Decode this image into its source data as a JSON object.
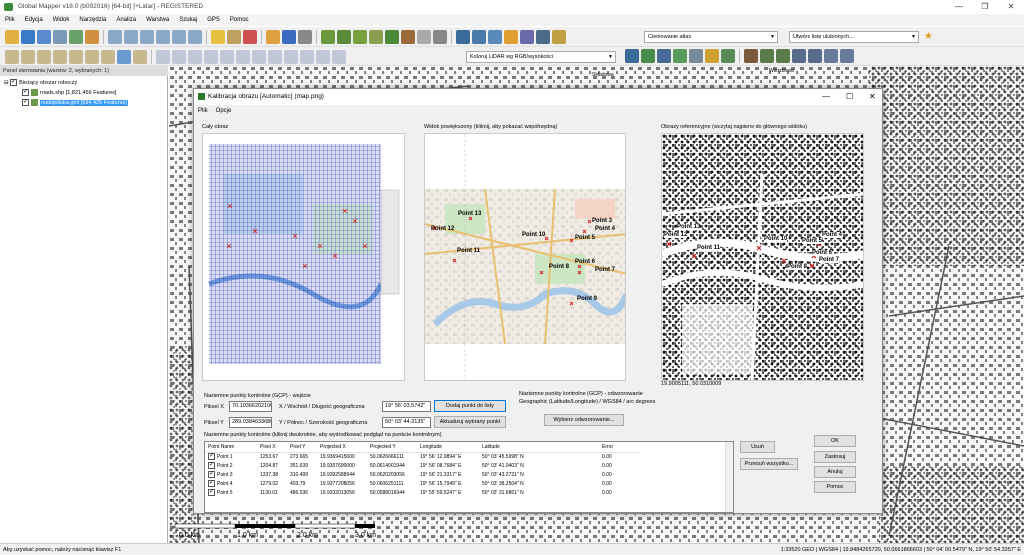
{
  "window": {
    "title": "Global Mapper v18.0 (b092016) [64-bit] [+Lidar] - REGISTERED",
    "controls": [
      "—",
      "❐",
      "✕"
    ]
  },
  "menubar": [
    "Plik",
    "Edycja",
    "Widok",
    "Narzędzia",
    "Analiza",
    "Warstwa",
    "Szukaj",
    "GPS",
    "Pomoc"
  ],
  "toolbar": {
    "shader_combo": "Cieniowanie atlas",
    "favorites_combo": "Utwórz listę ulubionych...",
    "lidar_combo": "Koloruj LiDAR wg RGB/wysokości"
  },
  "panel": {
    "header": "Panel sterowania (warstw: 2, wybranych: 1)",
    "root_label": "Bieżący obszar roboczy",
    "layers": [
      {
        "label": "roads.shp [1,821,456 Features]",
        "selected": false
      },
      {
        "label": "malopolska.gml [694,426 Features]",
        "selected": true
      }
    ]
  },
  "map": {
    "scale_labels": [
      "0.0 km",
      "1.0 km",
      "2.0 km",
      "3.0 km"
    ],
    "street_labels": [
      "Składowa",
      "Wierzbowa"
    ]
  },
  "status": {
    "left": "Aby uzyskać pomoc, należy nacisnąć klawisz F1",
    "right": "1:33520  GEO | WGS84 | 19.8484265720, 50.0661866603 | 50° 04' 00.5479\" N, 19° 50' 54.3357\" E"
  },
  "dialog": {
    "title": "Kalibracja obrazu [Automatic] (map.png)",
    "menu": [
      "Plik",
      "Opcje"
    ],
    "whole_image_label": "Cały obraz",
    "zoomed_label": "Widok powiększony (kliknij, aby pokazać współrzędną)",
    "reference_label": "Obrazy referencyjne (wczytaj najpierw do głównego widoku)",
    "reference_coords": "19.9005111, 50.0310009",
    "input_section": "Naziemne punkty kontrolne (GCP) - wejście",
    "pixel_x_label": "Piksel X",
    "pixel_x_value": "70.10366202100",
    "pixel_y_label": "Piksel Y",
    "pixel_y_value": "289.0384633680",
    "east_label": "X / Wschód / Długość geograficzna",
    "east_value": "19° 56' 03.5742\"",
    "north_label": "Y / Północ / Szerokość geograficzna",
    "north_value": "50° 03' 44.3135\"",
    "add_point_button": "Dodaj punkt do listy",
    "update_point_button": "Aktualizuj wybrany punkt",
    "output_section": "Naziemne punkty kontrolne (GCP) - odwzorowanie",
    "projection_text": "Geographic (Latitude/Longitude) / WGS84 / arc degrees",
    "select_projection_button": "Wybierz odwzorowanie...",
    "table_label": "Naziemne punkty kontrolne (kliknij dwukrotnie, aby wyśrodkować podgląd na punkcie kontrolnym)",
    "table_headers": [
      "Point Name",
      "Pixel X",
      "Pixel Y",
      "Projected X",
      "Projected Y",
      "Longitude",
      "Latitude",
      "Error"
    ],
    "rows": [
      [
        "Point 1",
        "1253.67",
        "273.665",
        "19.9369415000",
        "50.0626666111",
        "19° 56' 12.9894\" E",
        "50° 03' 45.5998\" N",
        "0.00"
      ],
      [
        "Point 2",
        "1204.87",
        "351.639",
        "19.9357690000",
        "50.0614001944",
        "19° 56' 08.7684\" E",
        "50° 03' 41.0403\" N",
        "0.00"
      ],
      [
        "Point 3",
        "1337.38",
        "310.499",
        "19.9392588944",
        "50.0620203056",
        "19° 56' 21.3317\" E",
        "50° 03' 43.2731\" N",
        "0.00"
      ],
      [
        "Point 4",
        "1279.02",
        "403.79",
        "19.9377208056",
        "50.0606251111",
        "19° 56' 15.7949\" E",
        "50° 03' 38.2504\" N",
        "0.00"
      ],
      [
        "Point 5",
        "1130.01",
        "486.536",
        "19.9332013056",
        "50.0588016944",
        "19° 55' 59.5247\" E",
        "50° 03' 31.6861\" N",
        "0.00"
      ]
    ],
    "remove_button": "Usuń",
    "shift_all_button": "Przesuń wszystko...",
    "ok_button": "OK",
    "apply_button": "Zastosuj",
    "cancel_button": "Anuluj",
    "help_button": "Pomoc",
    "zoom_points": [
      "Point 3",
      "Point 5",
      "Point 4",
      "Point 10",
      "Point 11",
      "Point 12",
      "Point 13",
      "Point 6",
      "Point 7",
      "Point 8",
      "Point 9"
    ],
    "ref_points": [
      "Point 13",
      "Point 12",
      "Point 11",
      "Point 10",
      "Point 4",
      "Point 5",
      "Point 6",
      "Point 7",
      "Point 8"
    ]
  }
}
